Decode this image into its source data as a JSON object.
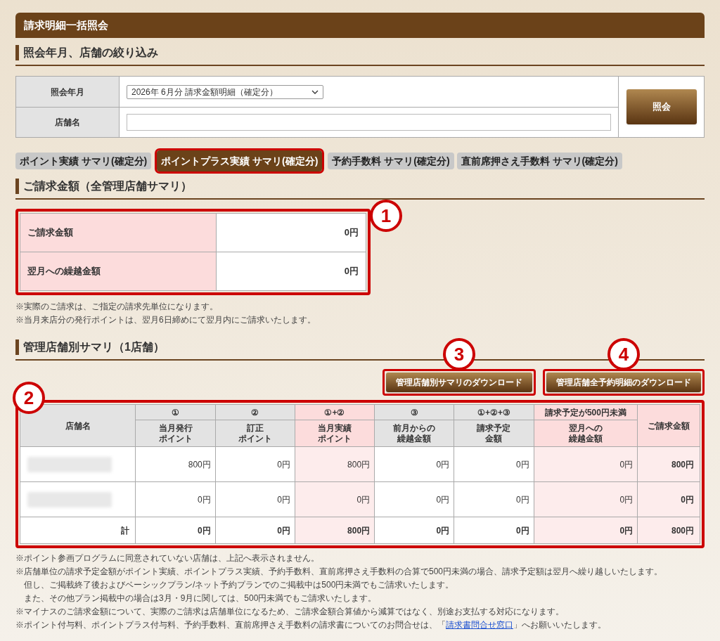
{
  "header": {
    "title": "請求明細一括照会"
  },
  "filter_section": {
    "title": "照会年月、店舗の絞り込み"
  },
  "filter": {
    "rows": [
      {
        "kind": "select",
        "label": "照会年月",
        "value": "2026年 6月分 請求金額明細（確定分）"
      },
      {
        "kind": "text",
        "label": "店舗名"
      }
    ],
    "button": "照会"
  },
  "tabs": [
    {
      "label": "ポイント実績 サマリ(確定分)",
      "selected": false
    },
    {
      "label": "ポイントプラス実績 サマリ(確定分)",
      "selected": true
    },
    {
      "label": "予約手数料 サマリ(確定分)",
      "selected": false
    },
    {
      "label": "直前席押さえ手数料 サマリ(確定分)",
      "selected": false
    }
  ],
  "summary_section": {
    "title": "ご請求金額（全管理店舗サマリ）"
  },
  "summary": {
    "callout": "1",
    "rows": [
      {
        "label": "ご請求金額",
        "value": "0円"
      },
      {
        "label": "翌月への繰越金額",
        "value": "0円"
      }
    ]
  },
  "summary_notes": [
    "※実際のご請求は、ご指定の請求先単位になります。",
    "※当月来店分の発行ポイントは、翌月6日締めにて翌月内にご請求いたします。"
  ],
  "store_section": {
    "title": "管理店舗別サマリ（1店舗）"
  },
  "downloads": [
    {
      "label": "管理店舗別サマリのダウンロード",
      "callout": "3"
    },
    {
      "label": "管理店舗全予約明細のダウンロード",
      "callout": "4"
    }
  ],
  "table": {
    "callout": "2",
    "store_header": "店舗名",
    "total_header": "ご請求金額",
    "groups": [
      {
        "label": "①",
        "highlight": false,
        "columns": [
          [
            "当月発行",
            "ポイント"
          ]
        ]
      },
      {
        "label": "②",
        "highlight": false,
        "columns": [
          [
            "訂正",
            "ポイント"
          ]
        ]
      },
      {
        "label": "①+②",
        "highlight": true,
        "columns": [
          [
            "当月実績",
            "ポイント"
          ]
        ]
      },
      {
        "label": "③",
        "highlight": false,
        "columns": [
          [
            "前月からの",
            "繰越金額"
          ]
        ]
      },
      {
        "label": "①+②+③",
        "highlight": false,
        "columns": [
          [
            "請求予定",
            "金額"
          ]
        ]
      },
      {
        "label": "請求予定が500円未満",
        "highlight": true,
        "columns": [
          [
            "翌月への",
            "繰越金額"
          ]
        ]
      }
    ],
    "rows": [
      {
        "kind": "store",
        "values": [
          "800円",
          "0円",
          "800円",
          "0円",
          "0円",
          "0円"
        ],
        "total": "800円"
      },
      {
        "kind": "store",
        "values": [
          "0円",
          "0円",
          "0円",
          "0円",
          "0円",
          "0円"
        ],
        "total": "0円"
      },
      {
        "kind": "total",
        "label": "計",
        "values": [
          "0円",
          "0円",
          "800円",
          "0円",
          "0円",
          "0円"
        ],
        "total": "800円"
      }
    ]
  },
  "notes": [
    {
      "indent": false,
      "text": "※ポイント参画プログラムに同意されていない店舗は、上記へ表示されません。"
    },
    {
      "indent": false,
      "text": "※店舗単位の請求予定金額がポイント実績、ポイントプラス実績、予約手数料、直前席押さえ手数料の合算で500円未満の場合、請求予定額は翌月へ繰り越しいたします。"
    },
    {
      "indent": true,
      "text": "但し、ご掲載終了後およびベーシックプラン/ネット予約プランでのご掲載中は500円未満でもご請求いたします。"
    },
    {
      "indent": true,
      "text": "また、その他プラン掲載中の場合は3月・9月に関しては、500円未満でもご請求いたします。"
    },
    {
      "indent": false,
      "text": "※マイナスのご請求金額について、実際のご請求は店舗単位になるため、ご請求金額合算値から減算ではなく、別途お支払する対応になります。"
    },
    {
      "indent": false,
      "text": "※ポイント付与料、ポイントプラス付与料、予約手数料、直前席押さえ手数料の請求書についてのお問合せは、「",
      "link": "請求書問合せ窓口",
      "after": "」へお願いいたします。"
    }
  ]
}
